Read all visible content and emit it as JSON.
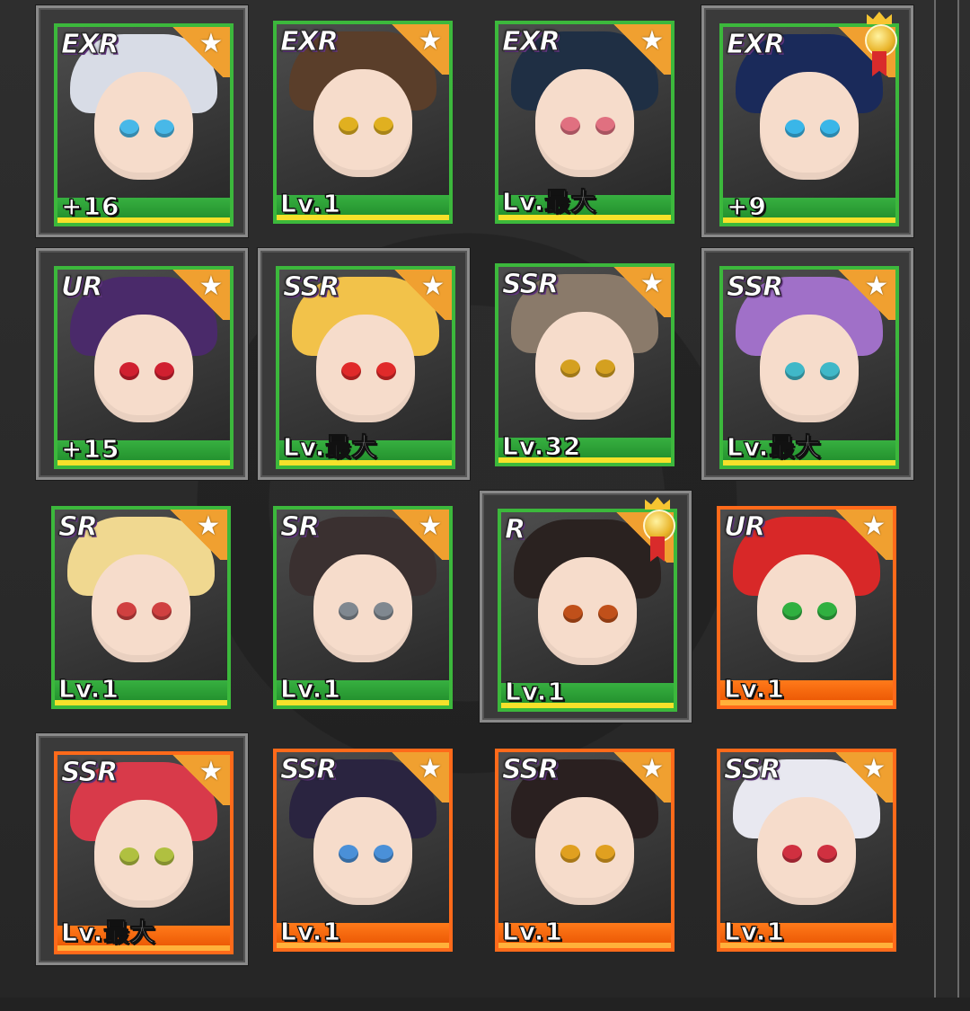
{
  "cards": [
    {
      "rarity": "EXR",
      "level": "+16",
      "style": "green",
      "medal": false,
      "framed": true,
      "hair": "#d8dce6",
      "eyes": "#48b8e8"
    },
    {
      "rarity": "EXR",
      "level": "Lv.1",
      "style": "green",
      "medal": false,
      "framed": false,
      "hair": "#5a3e2a",
      "eyes": "#e0b020"
    },
    {
      "rarity": "EXR",
      "level": "Lv.最大",
      "style": "green",
      "medal": false,
      "framed": false,
      "hair": "#1f2f44",
      "eyes": "#e07080"
    },
    {
      "rarity": "EXR",
      "level": "+9",
      "style": "green",
      "medal": true,
      "framed": true,
      "hair": "#1a2a5a",
      "eyes": "#3ab6e8"
    },
    {
      "rarity": "UR",
      "level": "+15",
      "style": "green",
      "medal": false,
      "framed": true,
      "hair": "#4a2a6a",
      "eyes": "#d02030"
    },
    {
      "rarity": "SSR",
      "level": "Lv.最大",
      "style": "green",
      "medal": false,
      "framed": true,
      "hair": "#f2c24a",
      "eyes": "#e02a2a"
    },
    {
      "rarity": "SSR",
      "level": "Lv.32",
      "style": "green",
      "medal": false,
      "framed": false,
      "hair": "#8a7a6a",
      "eyes": "#d4a020"
    },
    {
      "rarity": "SSR",
      "level": "Lv.最大",
      "style": "green",
      "medal": false,
      "framed": true,
      "hair": "#a070c8",
      "eyes": "#40b8c8"
    },
    {
      "rarity": "SR",
      "level": "Lv.1",
      "style": "green",
      "medal": false,
      "framed": false,
      "hair": "#f0d890",
      "eyes": "#d04040"
    },
    {
      "rarity": "SR",
      "level": "Lv.1",
      "style": "green",
      "medal": false,
      "framed": false,
      "hair": "#3a3030",
      "eyes": "#808890"
    },
    {
      "rarity": "R",
      "level": "Lv.1",
      "style": "green",
      "medal": true,
      "framed": true,
      "hair": "#2a2220",
      "eyes": "#c0501a"
    },
    {
      "rarity": "UR",
      "level": "Lv.1",
      "style": "orange",
      "medal": false,
      "framed": false,
      "hair": "#d82828",
      "eyes": "#30b040"
    },
    {
      "rarity": "SSR",
      "level": "Lv.最大",
      "style": "orange",
      "medal": false,
      "framed": true,
      "hair": "#d83a4a",
      "eyes": "#b0c040"
    },
    {
      "rarity": "SSR",
      "level": "Lv.1",
      "style": "orange",
      "medal": false,
      "framed": false,
      "hair": "#2a2440",
      "eyes": "#4a90d8"
    },
    {
      "rarity": "SSR",
      "level": "Lv.1",
      "style": "orange",
      "medal": false,
      "framed": false,
      "hair": "#2a2020",
      "eyes": "#e0a020"
    },
    {
      "rarity": "SSR",
      "level": "Lv.1",
      "style": "orange",
      "medal": false,
      "framed": false,
      "hair": "#e8e8f0",
      "eyes": "#d03040"
    }
  ]
}
